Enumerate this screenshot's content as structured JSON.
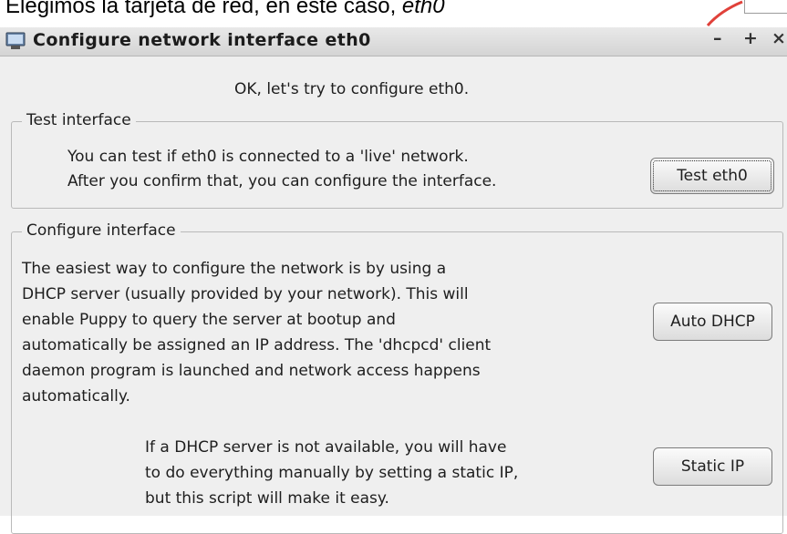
{
  "caption": {
    "prefix": "Elegimos la tarjeta de red, en este caso, ",
    "device": "eth0"
  },
  "window": {
    "title": "Configure network interface eth0",
    "controls": {
      "minimize": "–",
      "maximize": "+",
      "close": "×"
    },
    "icon": "monitor-icon"
  },
  "intro": "OK, let's try to configure eth0.",
  "test_section": {
    "legend": "Test interface",
    "lines": [
      "You can test if eth0 is connected to a 'live' network.",
      "After you confirm that, you can configure the interface."
    ],
    "button": "Test eth0"
  },
  "configure_section": {
    "legend": "Configure interface",
    "dhcp_lines": [
      "The easiest way to configure the network is by using a",
      "DHCP server (usually provided by your network). This will",
      "enable Puppy to query the server at bootup and",
      "automatically be assigned an IP address. The 'dhcpcd' client",
      "daemon program is launched and network access happens",
      "automatically."
    ],
    "dhcp_button": "Auto DHCP",
    "static_lines": [
      "If a DHCP server is not available, you will have",
      "to do everything manually by setting a static IP,",
      "but this script will make it easy."
    ],
    "static_button": "Static IP"
  },
  "colors": {
    "accent_red": "#e0413a",
    "window_bg": "#efefef",
    "titlebar": "#dcdcdc"
  }
}
